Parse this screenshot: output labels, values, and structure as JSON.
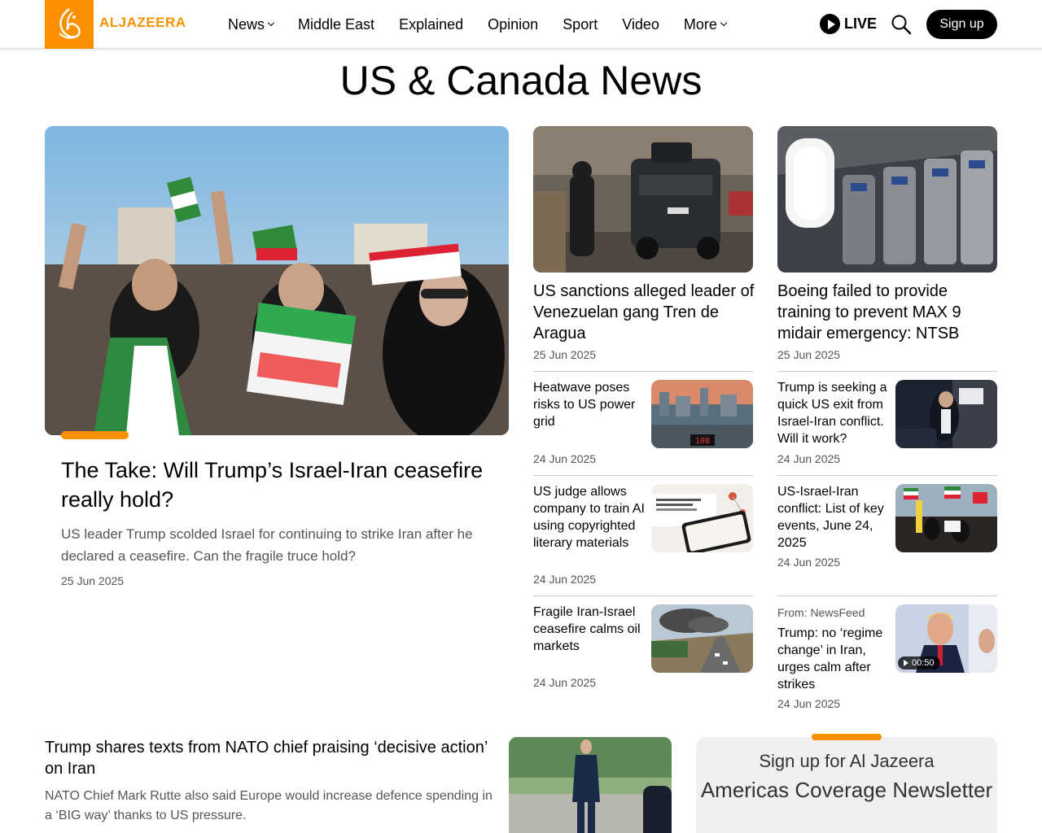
{
  "header": {
    "brand": "ALJAZEERA",
    "nav": [
      {
        "label": "News",
        "dropdown": true
      },
      {
        "label": "Middle East",
        "dropdown": false
      },
      {
        "label": "Explained",
        "dropdown": false
      },
      {
        "label": "Opinion",
        "dropdown": false
      },
      {
        "label": "Sport",
        "dropdown": false
      },
      {
        "label": "Video",
        "dropdown": false
      },
      {
        "label": "More",
        "dropdown": true
      }
    ],
    "live_label": "LIVE",
    "signup_label": "Sign up",
    "accent_color": "#fa9000"
  },
  "page_title": "US & Canada News",
  "featured": {
    "title": "The Take: Will Trump’s Israel-Iran ceasefire really hold?",
    "summary": "US leader Trump scolded Israel for continuing to strike Iran after he declared a ceasefire. Can the fragile truce hold?",
    "date": "25 Jun 2025"
  },
  "top_stories": [
    {
      "title": "US sanctions alleged leader of Venezuelan gang Tren de Aragua",
      "date": "25 Jun 2025"
    },
    {
      "title": "Boeing failed to provide training to prevent MAX 9 midair emergency: NTSB",
      "date": "25 Jun 2025"
    }
  ],
  "left_list": [
    {
      "title": "Heatwave poses risks to US power grid",
      "date": "24 Jun 2025"
    },
    {
      "title": "US judge allows company to train AI using copyrighted literary materials",
      "date": "24 Jun 2025"
    },
    {
      "title": "Fragile Iran-Israel ceasefire calms oil markets",
      "date": "24 Jun 2025"
    }
  ],
  "right_list": [
    {
      "title": "Trump is seeking a quick US exit from Israel-Iran conflict. Will it work?",
      "date": "24 Jun 2025"
    },
    {
      "title": "US-Israel-Iran conflict: List of key events, June 24, 2025",
      "date": "24 Jun 2025"
    },
    {
      "source": "From: NewsFeed",
      "title": "Trump: no ‘regime change’ in Iran, urges calm after strikes",
      "date": "24 Jun 2025",
      "duration": "00:50"
    }
  ],
  "bottom_story": {
    "title": "Trump shares texts from NATO chief praising ‘decisive action’ on Iran",
    "summary": "NATO Chief Mark Rutte also said Europe would increase defence spending in a ‘BIG way’ thanks to US pressure."
  },
  "newsletter": {
    "subtitle": "Sign up for Al Jazeera",
    "title": "Americas Coverage Newsletter"
  },
  "image_labels": {
    "thermometer": "108"
  }
}
